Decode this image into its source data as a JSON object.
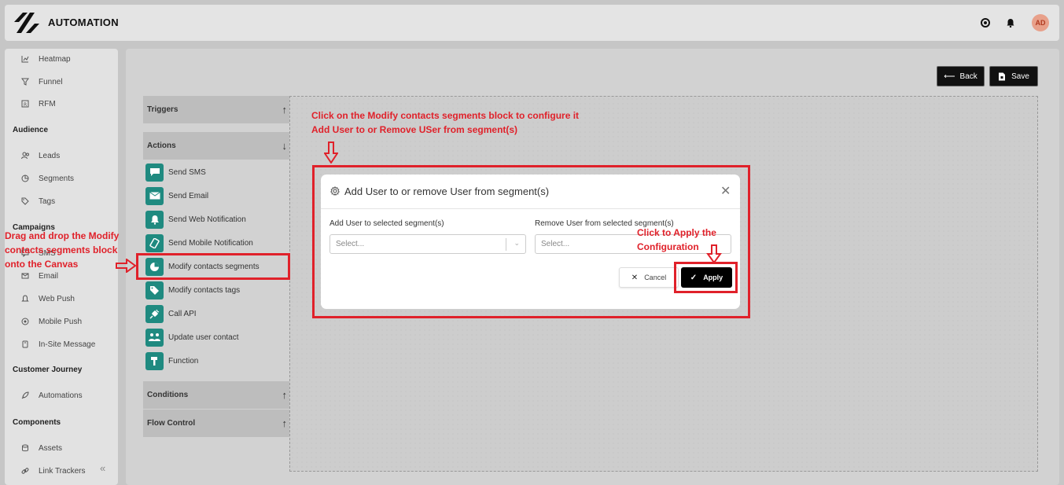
{
  "app": {
    "title": "AUTOMATION",
    "avatar": "AD"
  },
  "colors": {
    "annotation": "#e0212a",
    "accent": "#1f8a80",
    "dark": "#111111"
  },
  "sidebar": {
    "items_top": [
      {
        "label": "Heatmap",
        "icon": "heatmap-icon"
      },
      {
        "label": "Funnel",
        "icon": "funnel-icon"
      },
      {
        "label": "RFM",
        "icon": "rfm-icon"
      }
    ],
    "audience_heading": "Audience",
    "audience": [
      {
        "label": "Leads",
        "icon": "users-icon"
      },
      {
        "label": "Segments",
        "icon": "pie-icon"
      },
      {
        "label": "Tags",
        "icon": "tag-icon"
      }
    ],
    "campaigns_heading": "Campaigns",
    "campaigns": [
      {
        "label": "SMS",
        "icon": "sms-icon"
      },
      {
        "label": "Email",
        "icon": "mail-icon"
      },
      {
        "label": "Web Push",
        "icon": "bell-icon"
      },
      {
        "label": "Mobile Push",
        "icon": "mobile-icon"
      },
      {
        "label": "In-Site Message",
        "icon": "message-icon"
      }
    ],
    "journey_heading": "Customer Journey",
    "journey": [
      {
        "label": "Automations",
        "icon": "rocket-icon"
      }
    ],
    "components_heading": "Components",
    "components": [
      {
        "label": "Assets",
        "icon": "database-icon"
      },
      {
        "label": "Link Trackers",
        "icon": "link-icon"
      }
    ]
  },
  "toolbar": {
    "back_label": "Back",
    "save_label": "Save"
  },
  "palette": {
    "triggers": "Triggers",
    "actions": "Actions",
    "conditions": "Conditions",
    "flow_control": "Flow Control",
    "action_items": [
      "Send SMS",
      "Send Email",
      "Send Web Notification",
      "Send Mobile Notification",
      "Modify contacts segments",
      "Modify contacts tags",
      "Call API",
      "Update user contact",
      "Function"
    ]
  },
  "modal": {
    "title": "Add User to or remove User from segment(s)",
    "add_label": "Add User to selected segment(s)",
    "remove_label": "Remove User from selected segment(s)",
    "add_placeholder": "Select...",
    "remove_placeholder": "Select...",
    "cancel_label": "Cancel",
    "apply_label": "Apply"
  },
  "annotations": {
    "canvas_line1": "Click on the Modify contacts segments block to configure it",
    "canvas_line2": "Add User to or Remove USer from segment(s)",
    "drag_line1": "Drag and drop the Modify",
    "drag_line2": "contacts segments block",
    "drag_line3": "onto the Canvas",
    "apply_line1": "Click to Apply the",
    "apply_line2": "Configuration"
  }
}
